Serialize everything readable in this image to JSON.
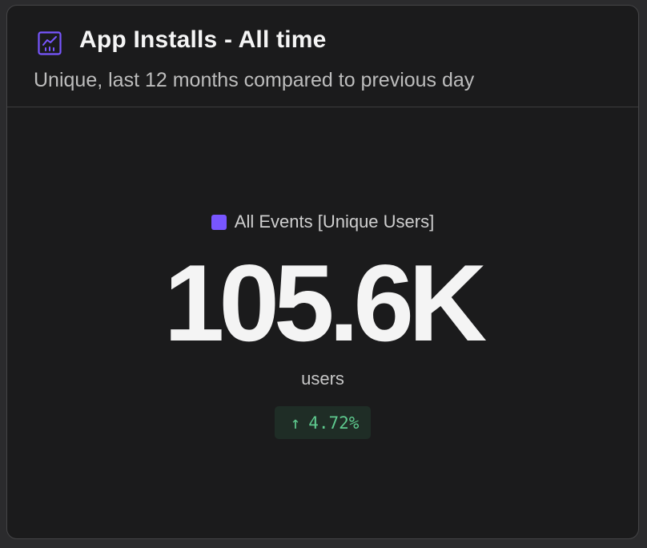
{
  "card": {
    "title": "App Installs - All time",
    "subtitle": "Unique, last 12 months compared to previous day",
    "icon": "line-chart-icon"
  },
  "metric": {
    "legend_label": "All Events [Unique Users]",
    "value": "105.6K",
    "unit": "users",
    "change": {
      "direction": "up",
      "arrow": "↑",
      "value": "4.72%"
    }
  },
  "colors": {
    "accent": "#7856ff",
    "positive": "#5ec98e",
    "positive_bg": "#1f2d26"
  }
}
